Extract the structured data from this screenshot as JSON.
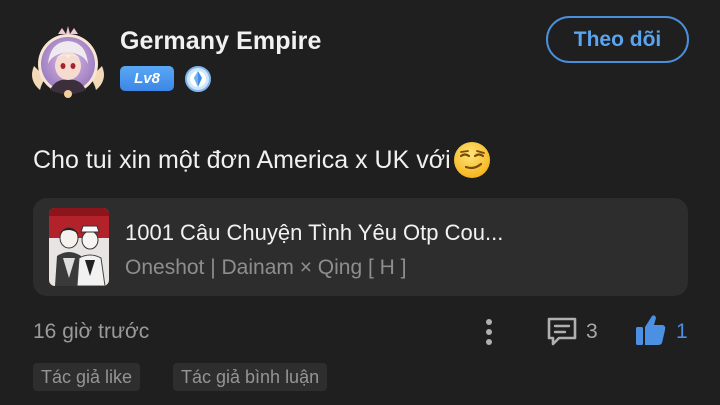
{
  "user": {
    "name": "Germany Empire",
    "level": "Lv8",
    "avatar_icon": "anime-character-avatar",
    "rank_icon": "diamond-rank-icon"
  },
  "follow_button": {
    "label": "Theo dõi"
  },
  "comment": {
    "text": "Cho tui xin một đơn America x UK với",
    "emoji": "smirking-face-emoji"
  },
  "story": {
    "title": "1001 Câu Chuyện Tình Yêu Otp Cou...",
    "meta": "Oneshot | Dainam × Qing [ H ]",
    "cover_icon": "story-cover-art"
  },
  "footer": {
    "timestamp": "16 giờ trước",
    "reply_count": "3",
    "like_count": "1"
  },
  "tags": {
    "like": "Tác giả like",
    "comment": "Tác giả bình luận"
  },
  "colors": {
    "background": "#1f1f1f",
    "card": "#2d2d2d",
    "accent": "#4b90e2",
    "level_badge": "#3c86e6"
  }
}
